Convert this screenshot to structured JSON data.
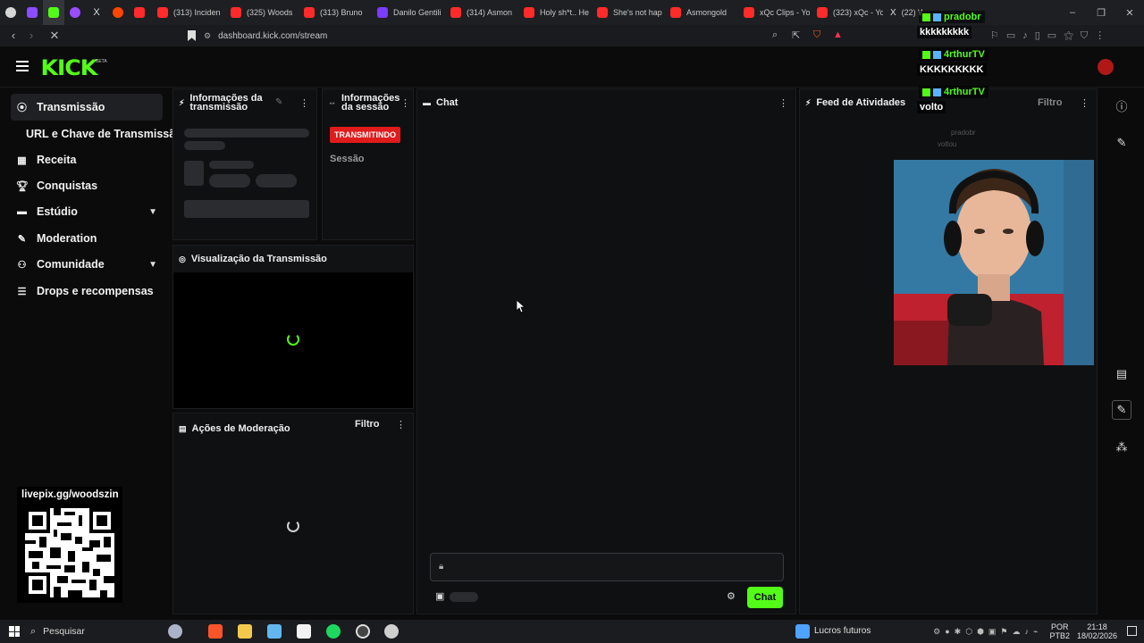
{
  "browser": {
    "tabs": [
      {
        "label": "(313) Inciden",
        "color": "#ff2a2a"
      },
      {
        "label": "(325) Woods",
        "color": "#ff2a2a"
      },
      {
        "label": "(313) Bruno",
        "color": "#ff2a2a"
      },
      {
        "label": "Danilo Gentili",
        "color": "#7a3cff"
      },
      {
        "label": "(314) Asmon",
        "color": "#ff2a2a"
      },
      {
        "label": "Holy sh*t.. He",
        "color": "#ff2a2a"
      },
      {
        "label": "She's not hap",
        "color": "#ff2a2a"
      },
      {
        "label": "Asmongold",
        "color": "#ff2a2a"
      },
      {
        "label": "xQc Clips - Yo",
        "color": "#ff2a2a"
      },
      {
        "label": "(323) xQc - Yo",
        "color": "#ff2a2a"
      },
      {
        "label": "(22) Wo",
        "color": "#dddddd"
      }
    ],
    "url": "dashboard.kick.com/stream"
  },
  "kick": {
    "logo": "KICK",
    "beta": "BETA"
  },
  "sidebar": {
    "items": [
      {
        "label": "Transmissão",
        "icon": "broadcast-icon"
      },
      {
        "label": "URL e Chave de Transmissão"
      },
      {
        "label": "Receita",
        "icon": "chart-icon"
      },
      {
        "label": "Conquistas",
        "icon": "trophy-icon"
      },
      {
        "label": "Estúdio",
        "icon": "studio-icon"
      },
      {
        "label": "Moderation",
        "icon": "wrench-icon"
      },
      {
        "label": "Comunidade",
        "icon": "people-icon"
      },
      {
        "label": "Drops e recompensas",
        "icon": "drops-icon"
      }
    ]
  },
  "qr": {
    "text": "livepix.gg/woodszin"
  },
  "panels": {
    "stream_info": "Informações da transmissão",
    "session_info": "Informações da sessão",
    "status_badge": "TRANSMITINDO",
    "session_label": "Sessão",
    "preview": "Visualização da Transmissão",
    "mod_actions": "Ações de Moderação",
    "mod_filter": "Filtro",
    "chat": "Chat",
    "chat_button": "Chat",
    "activity_feed": "Feed de Atividades",
    "activity_filter": "Filtro"
  },
  "overlay_chat": [
    {
      "user": "pradobr",
      "text": "kkkkkkkkk"
    },
    {
      "user": "4rthurTV",
      "text": "KKKKKKKKK"
    },
    {
      "user": "4rthurTV",
      "text": "volto"
    }
  ],
  "overlay_faded": {
    "user": "pradobr",
    "text": "voltou"
  },
  "taskbar": {
    "search": "Pesquisar",
    "widget": "Lucros futuros",
    "lang": "POR",
    "layout": "PTB2",
    "time": "21:18",
    "date": "18/02/2026"
  }
}
